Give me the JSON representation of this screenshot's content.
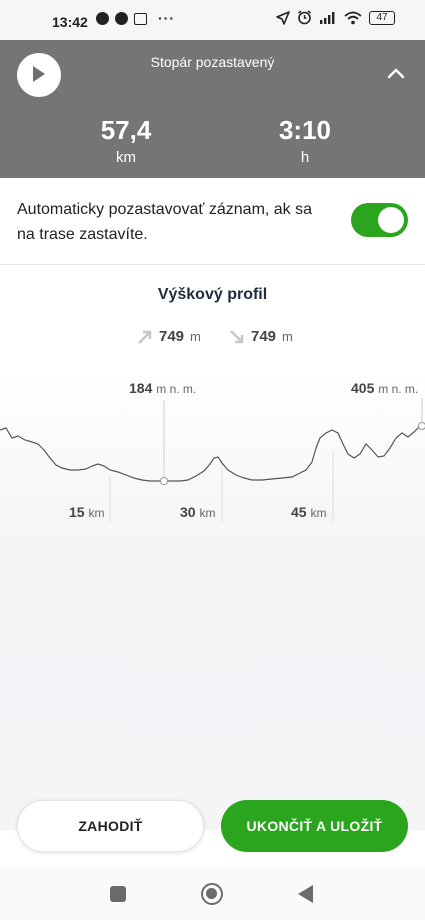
{
  "status_bar": {
    "time": "13:42",
    "more": "···",
    "battery": "47"
  },
  "header": {
    "title": "Stopár pozastavený",
    "distance_value": "57,4",
    "distance_unit": "km",
    "time_value": "3:10",
    "time_unit": "h",
    "play_icon": "play-icon",
    "collapse_icon": "chevron-up-icon",
    "background_color": "#757575"
  },
  "auto_pause": {
    "text": "Automaticky pozastavovať záznam, ak sa na trase zastavíte.",
    "enabled": true,
    "toggle_color": "#2aa51d"
  },
  "profile": {
    "title": "Výškový profil",
    "ascent_value": "749",
    "ascent_unit": "m",
    "descent_value": "749",
    "descent_unit": "m",
    "min_elevation_value": "184",
    "min_elevation_unit": "m n. m.",
    "max_elevation_value": "405",
    "max_elevation_unit": "m n. m.",
    "km_markers": [
      {
        "value": "15",
        "unit": "km"
      },
      {
        "value": "30",
        "unit": "km"
      },
      {
        "value": "45",
        "unit": "km"
      }
    ]
  },
  "actions": {
    "discard_label": "ZAHODIŤ",
    "finish_label": "UKONČIŤ A ULOŽIŤ",
    "accent_color": "#2aa51d"
  }
}
